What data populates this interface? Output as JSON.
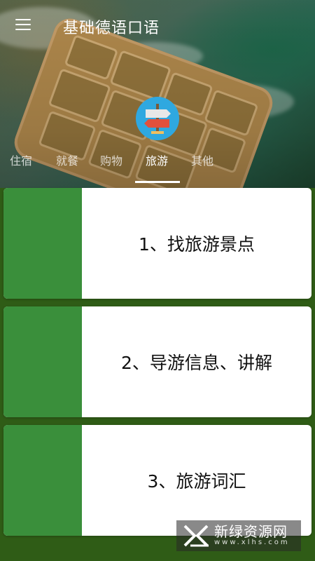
{
  "app": {
    "title": "基础德语口语"
  },
  "tabs": [
    {
      "label": "住宿"
    },
    {
      "label": "就餐"
    },
    {
      "label": "购物"
    },
    {
      "label": "旅游"
    },
    {
      "label": "其他"
    }
  ],
  "active_tab": "旅游",
  "category_icon": "signpost-icon",
  "lessons": [
    {
      "label": "1、找旅游景点"
    },
    {
      "label": "2、导游信息、讲解"
    },
    {
      "label": "3、旅游词汇"
    }
  ],
  "watermark": {
    "cn": "新绿资源网",
    "en": "www.xlhs.com"
  },
  "colors": {
    "accent_stripe": "#3a8f3b",
    "page_background": "#2f5c16",
    "card_background": "#ffffff"
  }
}
